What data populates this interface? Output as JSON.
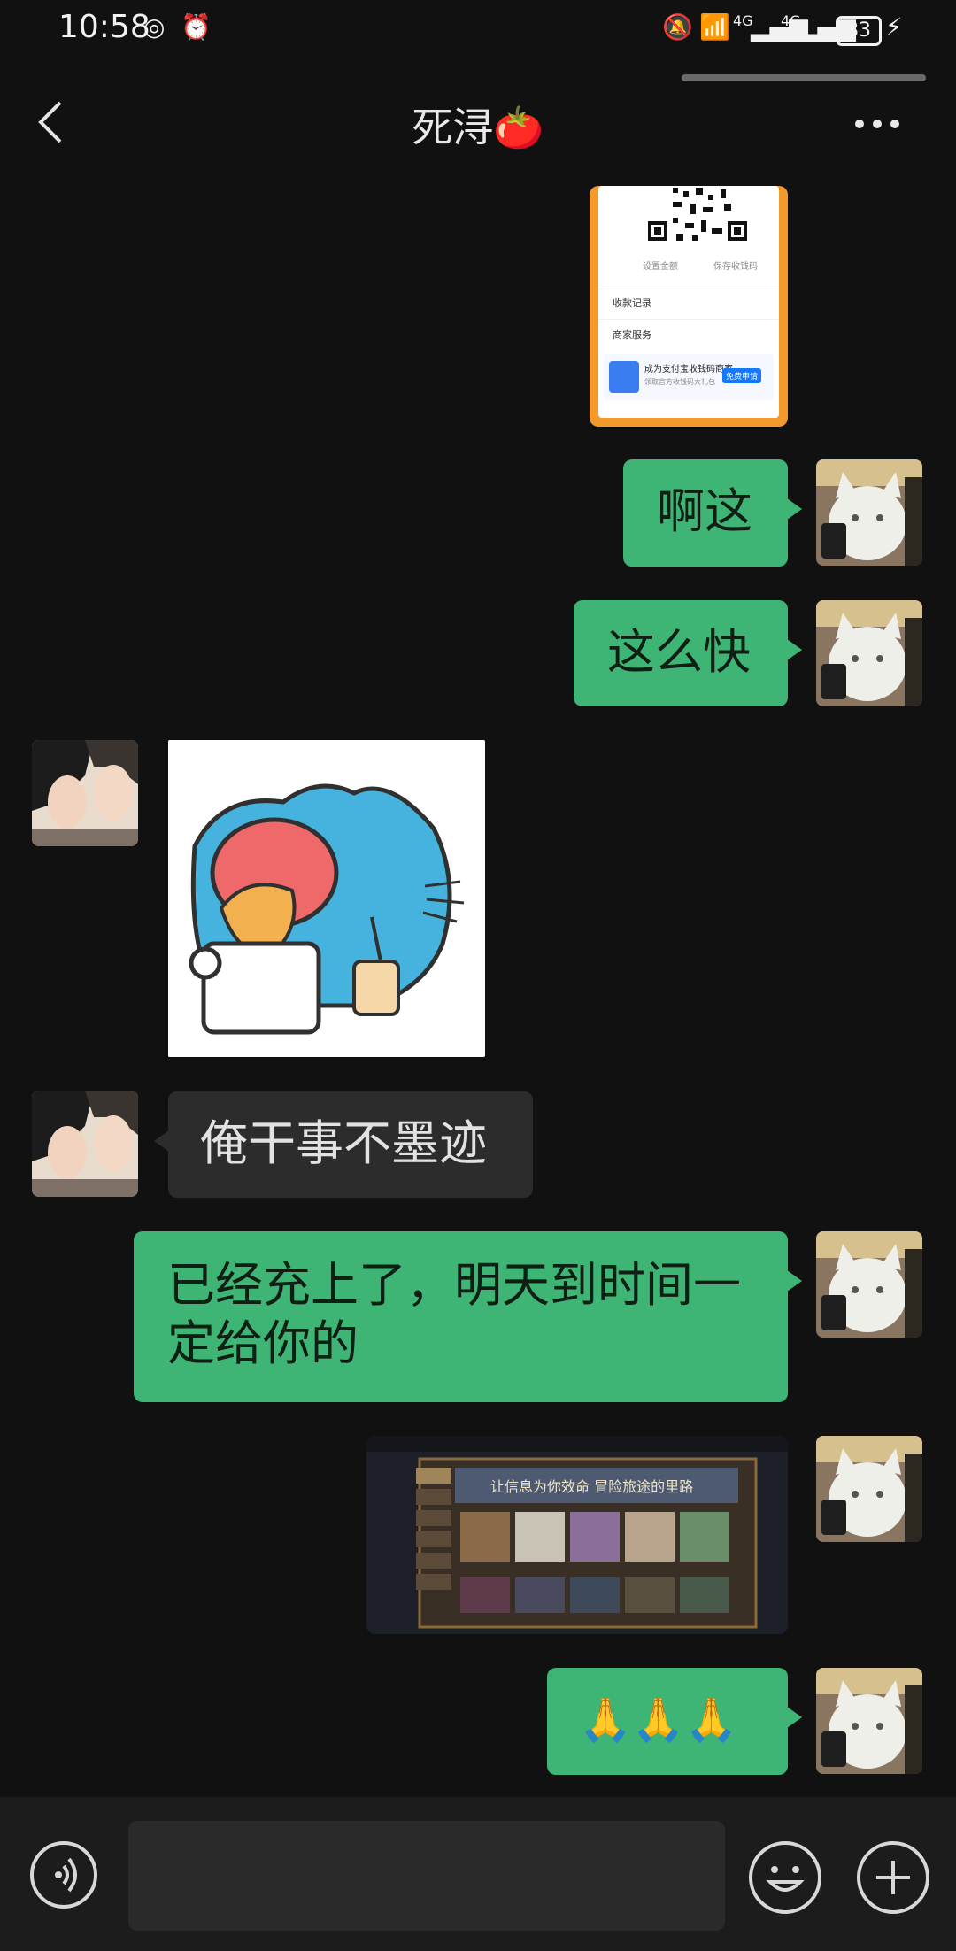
{
  "status_bar": {
    "time": "10:58",
    "signal_1": "4G",
    "signal_2": "4G",
    "battery": "83"
  },
  "header": {
    "title": "死浔🍅"
  },
  "messages": [
    {
      "from": "me",
      "type": "image",
      "image_name": "payment-qr-screenshot",
      "qr_labels": [
        "设置金额",
        "保存收钱码"
      ],
      "rows": [
        "收款记录",
        "商家服务",
        "成为支付宝收钱码商家",
        "领取官方收钱码大礼包",
        "免费申请"
      ]
    },
    {
      "from": "me",
      "type": "text",
      "text": "啊这"
    },
    {
      "from": "me",
      "type": "text",
      "text": "这么快"
    },
    {
      "from": "other",
      "type": "sticker",
      "image_name": "blue-cat-eating-sticker"
    },
    {
      "from": "other",
      "type": "text",
      "text": "俺干事不墨迹"
    },
    {
      "from": "me",
      "type": "text",
      "text": "已经充上了，明天到时间一定给你的"
    },
    {
      "from": "me",
      "type": "image",
      "image_name": "game-store-screenshot",
      "banner": "让信息为你效命 冒险旅途的里路"
    },
    {
      "from": "me",
      "type": "text",
      "text": "🙏🙏🙏"
    }
  ],
  "colors": {
    "background": "#111111",
    "my_bubble": "#3eb575",
    "their_bubble": "#2c2c2c"
  }
}
